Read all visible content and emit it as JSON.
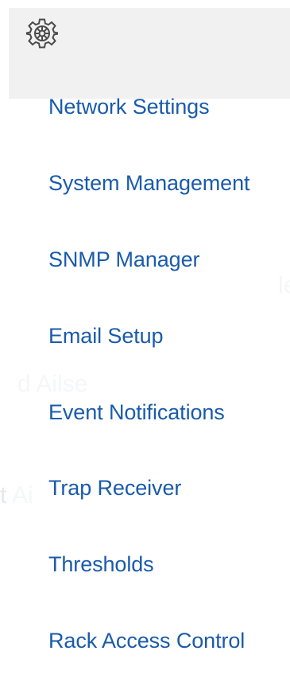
{
  "background_text": {
    "fragment_1": "le",
    "fragment_2": "d Ailse",
    "fragment_3": "t Ai"
  },
  "menu": {
    "header_icon": "gear-icon",
    "items": [
      {
        "label": "Network Settings"
      },
      {
        "label": "System Management"
      },
      {
        "label": "SNMP Manager"
      },
      {
        "label": "Email Setup"
      },
      {
        "label": "Event Notifications"
      },
      {
        "label": "Trap Receiver"
      },
      {
        "label": "Thresholds"
      },
      {
        "label": "Rack Access Control"
      }
    ]
  },
  "colors": {
    "link": "#1a5bab",
    "header_bg": "#f1f1f1",
    "icon": "#4a4a4a",
    "ghost_text": "#e6e8ec"
  }
}
